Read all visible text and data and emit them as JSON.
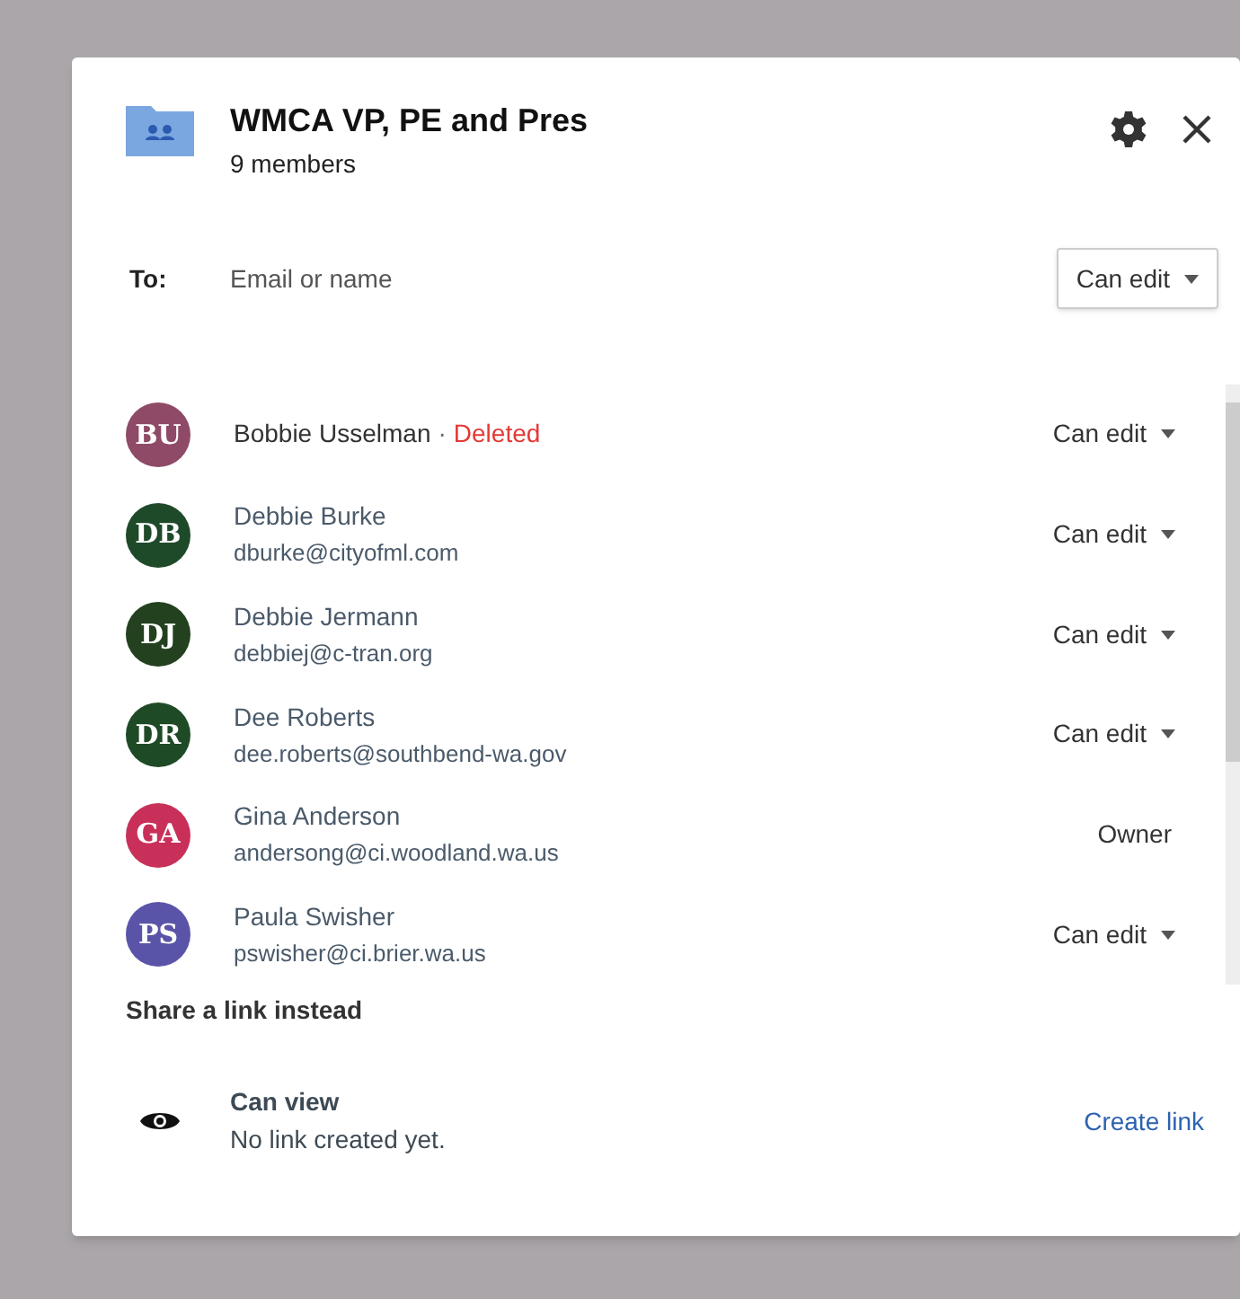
{
  "dialog": {
    "title": "WMCA VP, PE and Pres",
    "subtitle": "9 members"
  },
  "to": {
    "label": "To:",
    "placeholder": "Email or name",
    "permission": "Can edit"
  },
  "members": [
    {
      "initials": "BU",
      "color": "#8e4a66",
      "name": "Bobbie Usselman",
      "separator": "·",
      "status": "Deleted",
      "role": "Can edit",
      "kind": "dropdown"
    },
    {
      "initials": "DB",
      "color": "#1f4a2a",
      "name": "Debbie Burke",
      "email": "dburke@cityofml.com",
      "role": "Can edit",
      "kind": "dropdown"
    },
    {
      "initials": "DJ",
      "color": "#23401f",
      "name": "Debbie Jermann",
      "email": "debbiej@c-tran.org",
      "role": "Can edit",
      "kind": "dropdown"
    },
    {
      "initials": "DR",
      "color": "#1f4a26",
      "name": "Dee Roberts",
      "email": "dee.roberts@southbend-wa.gov",
      "role": "Can edit",
      "kind": "dropdown"
    },
    {
      "initials": "GA",
      "color": "#c8305a",
      "name": "Gina Anderson",
      "email": "andersong@ci.woodland.wa.us",
      "role": "Owner",
      "kind": "fixed"
    },
    {
      "initials": "PS",
      "color": "#5a54a8",
      "name": "Paula Swisher",
      "email": "pswisher@ci.brier.wa.us",
      "role": "Can edit",
      "kind": "dropdown"
    }
  ],
  "link_section": {
    "heading": "Share a link instead",
    "access": "Can view",
    "note": "No link created yet.",
    "action": "Create link"
  }
}
